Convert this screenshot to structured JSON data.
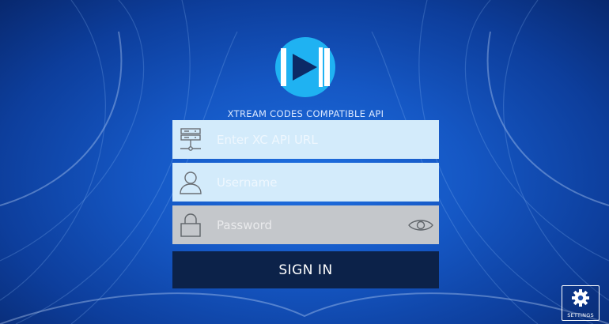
{
  "app": {
    "subtitle": "XTREAM CODES COMPATIBLE API"
  },
  "form": {
    "url_field": {
      "placeholder": "Enter XC API URL",
      "value": "",
      "icon": "server-icon"
    },
    "username_field": {
      "placeholder": "Username",
      "value": "",
      "icon": "user-icon"
    },
    "password_field": {
      "placeholder": "Password",
      "value": "",
      "icon": "lock-icon",
      "toggle_icon": "eye-icon"
    },
    "signin_label": "SIGN IN"
  },
  "settings": {
    "label": "SETTINGS",
    "icon": "gear-icon"
  },
  "colors": {
    "background": "#1557c4",
    "field_light": "#d3ebfb",
    "field_gray": "#c4c7cb",
    "signin_button": "#0c2249",
    "logo_circle": "#1fb2f2"
  }
}
